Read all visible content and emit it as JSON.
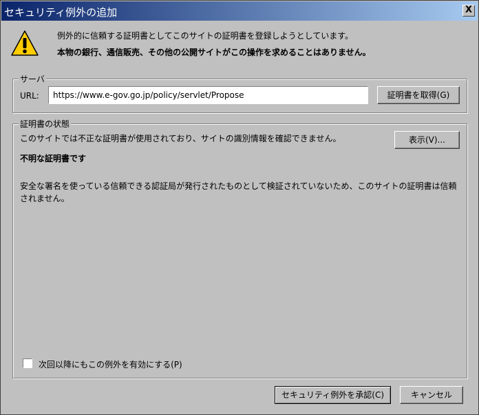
{
  "dialog": {
    "title": "セキュリティ例外の追加",
    "close_label": "X"
  },
  "warning": {
    "icon": "warning-icon",
    "line1": "例外的に信頼する証明書としてこのサイトの証明書を登録しようとしています。",
    "line2": "本物の銀行、通信販売、その他の公開サイトがこの操作を求めることはありません。"
  },
  "server": {
    "legend": "サーバ",
    "url_label": "URL:",
    "url_value": "https://www.e-gov.go.jp/policy/servlet/Propose",
    "get_cert_label": "証明書を取得(G)"
  },
  "status": {
    "legend": "証明書の状態",
    "summary": "このサイトでは不正な証明書が使用されており、サイトの識別情報を確認できません。",
    "view_label": "表示(V)...",
    "heading": "不明な証明書です",
    "detail": "安全な署名を使っている信頼できる認証局が発行されたものとして検証されていないため、このサイトの証明書は信頼されません。"
  },
  "permanent": {
    "checked": false,
    "label": "次回以降にもこの例外を有効にする(P)"
  },
  "actions": {
    "confirm_label": "セキュリティ例外を承認(C)",
    "cancel_label": "キャンセル"
  },
  "colors": {
    "titlebar_start": "#0a246a",
    "titlebar_end": "#a6caf0",
    "face": "#c0c0c0",
    "warning_yellow": "#ffcc00"
  }
}
